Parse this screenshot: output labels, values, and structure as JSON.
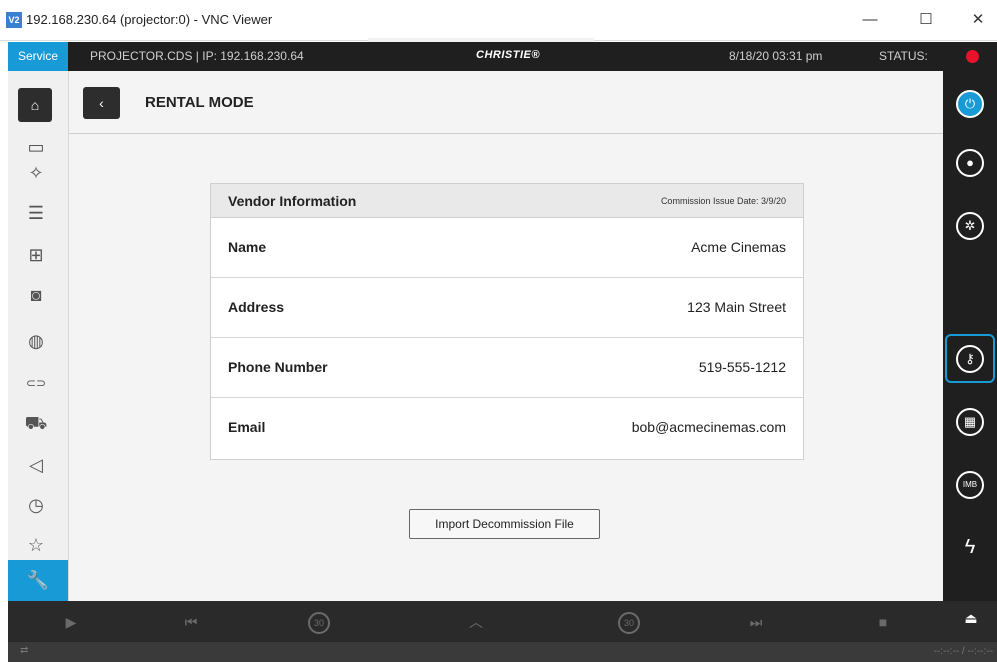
{
  "window": {
    "logo": "V2",
    "title": "192.168.230.64 (projector:0) - VNC Viewer",
    "controls": [
      "—",
      "☐",
      "✕"
    ]
  },
  "topbar": {
    "mode": "Service",
    "projector": "PROJECTOR.CDS | IP: 192.168.230.64",
    "brand": "CHRISTIE®",
    "datetime": "8/18/20  03:31 pm",
    "status_label": "STATUS:",
    "status_color": "#e8132a"
  },
  "leftbar": {
    "items": [
      {
        "icon": "home-icon",
        "glyph": "⌂"
      },
      {
        "icon": "display-layout-icon",
        "glyph": "▭"
      },
      {
        "icon": "sparkle-icon",
        "glyph": "✧"
      },
      {
        "icon": "checklist-icon",
        "glyph": "☰"
      },
      {
        "icon": "network-icon",
        "glyph": "⊞"
      },
      {
        "icon": "storage-icon",
        "glyph": "◙"
      },
      {
        "icon": "server-icon",
        "glyph": "◍"
      },
      {
        "icon": "link-icon",
        "glyph": "⊂⊃"
      },
      {
        "icon": "projector-icon",
        "glyph": "⛟"
      },
      {
        "icon": "speaker-icon",
        "glyph": "◁"
      },
      {
        "icon": "clock-icon",
        "glyph": "◷"
      },
      {
        "icon": "favorites-icon",
        "glyph": "☆"
      },
      {
        "icon": "wrench-icon",
        "glyph": "🔧"
      }
    ]
  },
  "main": {
    "back_glyph": "‹",
    "title": "RENTAL MODE",
    "vendor": {
      "heading": "Vendor Information",
      "commission_date": "Commission Issue Date: 3/9/20",
      "rows": [
        {
          "label": "Name",
          "value": "Acme Cinemas"
        },
        {
          "label": "Address",
          "value": "123 Main Street"
        },
        {
          "label": "Phone Number",
          "value": "519-555-1212"
        },
        {
          "label": "Email",
          "value": "bob@acmecinemas.com"
        }
      ]
    },
    "import_button": "Import Decommission File"
  },
  "rightbar": {
    "items": [
      {
        "icon": "power-icon",
        "glyph": "⏻"
      },
      {
        "icon": "lamp-icon",
        "glyph": "●"
      },
      {
        "icon": "shutter-icon",
        "glyph": "✲"
      },
      {
        "icon": "key-icon",
        "glyph": "⚷"
      },
      {
        "icon": "test-pattern-icon",
        "glyph": "▦"
      },
      {
        "icon": "imb-icon",
        "glyph": "IMB"
      },
      {
        "icon": "power-settings-icon",
        "glyph": "ϟ"
      }
    ]
  },
  "bottombar": {
    "buttons": [
      {
        "icon": "play-icon",
        "glyph": "▶"
      },
      {
        "icon": "skip-back-icon",
        "glyph": "⏮"
      },
      {
        "icon": "rewind-30-icon",
        "glyph": "30"
      },
      {
        "icon": "chevron-up-icon",
        "glyph": "︿"
      },
      {
        "icon": "forward-30-icon",
        "glyph": "30"
      },
      {
        "icon": "skip-forward-icon",
        "glyph": "⏭"
      },
      {
        "icon": "stop-icon",
        "glyph": "■"
      },
      {
        "icon": "eject-icon",
        "glyph": "⏏"
      }
    ]
  },
  "statusbar": {
    "left_glyph": "⇄",
    "timecode": "--:--:-- / --:--:--"
  }
}
